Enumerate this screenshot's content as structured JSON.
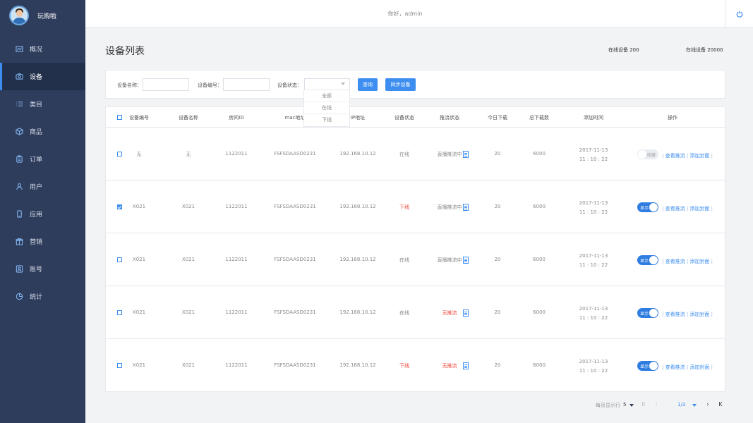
{
  "brand": {
    "name": "玩购啦"
  },
  "header": {
    "greeting": "你好，admin"
  },
  "sidebar": {
    "items": [
      {
        "label": "概况",
        "icon": "chart-icon"
      },
      {
        "label": "设备",
        "icon": "device-icon",
        "active": true
      },
      {
        "label": "类目",
        "icon": "list-icon"
      },
      {
        "label": "商品",
        "icon": "box-icon"
      },
      {
        "label": "订单",
        "icon": "clipboard-icon"
      },
      {
        "label": "用户",
        "icon": "user-icon"
      },
      {
        "label": "应用",
        "icon": "phone-icon"
      },
      {
        "label": "营销",
        "icon": "gift-icon"
      },
      {
        "label": "账号",
        "icon": "id-card-icon"
      },
      {
        "label": "统计",
        "icon": "pie-icon"
      }
    ]
  },
  "page": {
    "title": "设备列表",
    "stat_online": "在线设备 200",
    "stat_total": "在线设备 20000"
  },
  "filter": {
    "name_label": "设备名称：",
    "number_label": "设备编号：",
    "status_label": "设备状态：",
    "query_button": "查询",
    "sync_button": "同步设备",
    "status_options": [
      "全部",
      "在线",
      "下线"
    ]
  },
  "table": {
    "headers": [
      "设备编号",
      "设备名称",
      "房间ID",
      "mac地址",
      "IP地址",
      "设备状态",
      "推流状态",
      "今日下载",
      "总下载数",
      "添加时间",
      "操作"
    ],
    "rows": [
      {
        "checked": false,
        "number": "无",
        "name": "无",
        "room": "1122011",
        "mac": "FSFSDAASD0231",
        "ip": "192.168.10.12",
        "status": "在线",
        "status_red": false,
        "stream": "直播推流中",
        "stream_red": false,
        "today": "20",
        "total": "6000",
        "date": "2017-11-13",
        "time": "11 : 10 : 22",
        "toggle_on": false,
        "toggle_label": "隐藏"
      },
      {
        "checked": true,
        "number": "X021",
        "name": "X021",
        "room": "1122011",
        "mac": "FSFSDAASD0231",
        "ip": "192.168.10.12",
        "status": "下线",
        "status_red": true,
        "stream": "直播推流中",
        "stream_red": false,
        "today": "20",
        "total": "6000",
        "date": "2017-11-13",
        "time": "11 : 10 : 22",
        "toggle_on": true,
        "toggle_label": "显示"
      },
      {
        "checked": false,
        "number": "X021",
        "name": "X021",
        "room": "1122011",
        "mac": "FSFSDAASD0231",
        "ip": "192.168.10.12",
        "status": "在线",
        "status_red": false,
        "stream": "直播推流中",
        "stream_red": false,
        "today": "20",
        "total": "6000",
        "date": "2017-11-13",
        "time": "11 : 10 : 22",
        "toggle_on": true,
        "toggle_label": "显示"
      },
      {
        "checked": false,
        "number": "X021",
        "name": "X021",
        "room": "1122011",
        "mac": "FSFSDAASD0231",
        "ip": "192.168.10.12",
        "status": "在线",
        "status_red": false,
        "stream": "无推流",
        "stream_red": true,
        "today": "20",
        "total": "6000",
        "date": "2017-11-13",
        "time": "11 : 10 : 22",
        "toggle_on": true,
        "toggle_label": "显示"
      },
      {
        "checked": false,
        "number": "X021",
        "name": "X021",
        "room": "1122011",
        "mac": "FSFSDAASD0231",
        "ip": "192.168.10.12",
        "status": "下线",
        "status_red": true,
        "stream": "无推流",
        "stream_red": true,
        "today": "20",
        "total": "6000",
        "date": "2017-11-13",
        "time": "11 : 10 : 22",
        "toggle_on": true,
        "toggle_label": "显示"
      }
    ],
    "op_view": "查看推流",
    "op_cover": "添加封面"
  },
  "pager": {
    "per_page_label": "每页显示行",
    "per_page": "5",
    "page": "1/3"
  },
  "colors": {
    "accent": "#3d8ef0",
    "sidebar": "#2f3d5c",
    "danger": "#f0483e"
  }
}
